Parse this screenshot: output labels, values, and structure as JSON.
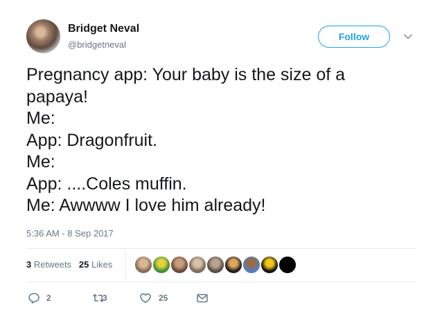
{
  "user": {
    "name": "Bridget Neval",
    "handle": "@bridgetneval",
    "follow_label": "Follow"
  },
  "tweet": {
    "lines": [
      "Pregnancy app: Your baby is the size of a",
      "papaya!",
      "Me:",
      "App: Dragonfruit.",
      "Me:",
      "App: ....Coles muffin.",
      "Me: Awwww I love him already!"
    ],
    "timestamp": "5:36 AM - 8 Sep 2017"
  },
  "stats": {
    "retweets_count": "3",
    "retweets_label": "Retweets",
    "likes_count": "25",
    "likes_label": "Likes"
  },
  "likers": [
    {
      "colors": [
        "#8a6a55",
        "#d9b89a"
      ]
    },
    {
      "colors": [
        "#3f8f3a",
        "#e4d13b"
      ]
    },
    {
      "colors": [
        "#6b4a3a",
        "#c99c7b"
      ]
    },
    {
      "colors": [
        "#7d6a5b",
        "#d7c2a8"
      ]
    },
    {
      "colors": [
        "#5a4d45",
        "#b8a48f"
      ]
    },
    {
      "colors": [
        "#1d1d1d",
        "#e0a45c"
      ]
    },
    {
      "colors": [
        "#4d80c7",
        "#9a6b42"
      ]
    },
    {
      "colors": [
        "#111111",
        "#f5c518"
      ]
    },
    {
      "colors": [
        "#000000",
        "#000000"
      ]
    }
  ],
  "actions": {
    "reply_count": "2",
    "retweet_count": "3",
    "like_count": "25"
  },
  "colors": {
    "accent": "#1da1f2",
    "text": "#14171a",
    "secondary": "#657786",
    "divider": "#e6ecf0"
  }
}
